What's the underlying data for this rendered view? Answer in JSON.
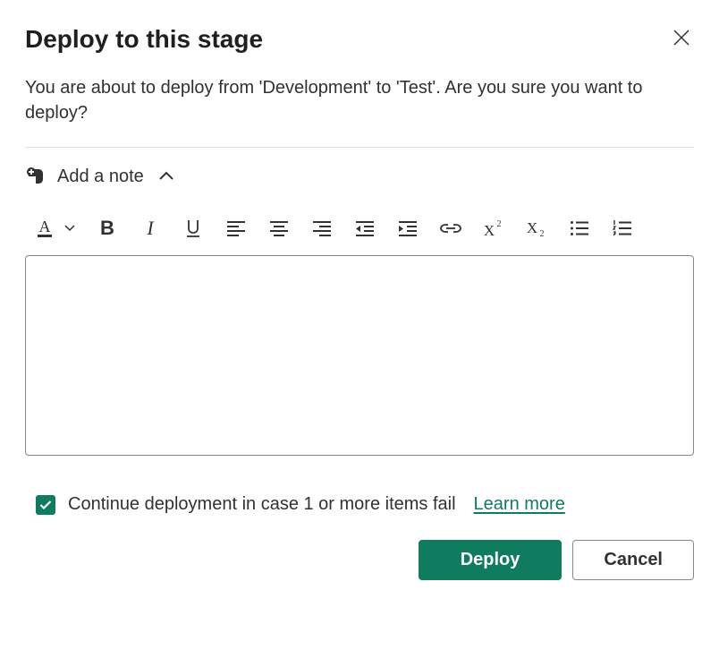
{
  "header": {
    "title": "Deploy to this stage"
  },
  "description": "You are about to deploy from 'Development' to 'Test'. Are you sure you want to deploy?",
  "note": {
    "label": "Add a note"
  },
  "toolbar": {
    "font_color": "font-color",
    "font_dropdown": "font-dropdown",
    "bold": "B",
    "italic": "I",
    "underline": "U",
    "align_left": "align-left",
    "align_center": "align-center",
    "align_right": "align-right",
    "outdent": "outdent",
    "indent": "indent",
    "link": "link",
    "superscript": "superscript",
    "subscript": "subscript",
    "bulleted_list": "bulleted-list",
    "numbered_list": "numbered-list"
  },
  "editor": {
    "value": "",
    "placeholder": ""
  },
  "footer": {
    "checkbox_checked": true,
    "checkbox_label": "Continue deployment in case 1 or more items fail",
    "learn_more": "Learn more"
  },
  "buttons": {
    "primary": "Deploy",
    "secondary": "Cancel"
  },
  "colors": {
    "accent": "#0f7b5f"
  }
}
